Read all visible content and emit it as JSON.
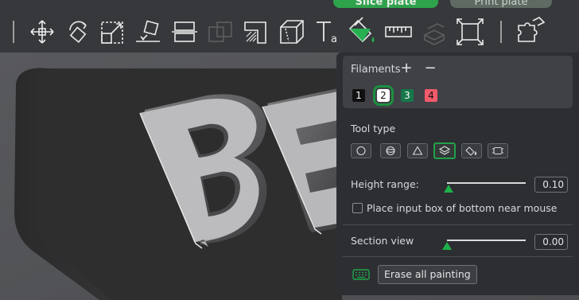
{
  "topbar": {
    "slice_button": "Slice plate",
    "print_button": "Print plate"
  },
  "toolbar": {
    "tools": [
      "move-icon",
      "rotate-icon",
      "scale-icon",
      "lay-on-face-icon",
      "cut-icon",
      "boolean-icon",
      "support-painting-icon",
      "seam-painting-icon",
      "text-icon",
      "color-painting-icon",
      "measure-icon",
      "assembly-icon",
      "fit-icon",
      "split-icon"
    ]
  },
  "viewport": {
    "model_text": "BE"
  },
  "panel": {
    "filaments_label": "Filaments",
    "add_symbol": "+",
    "remove_symbol": "−",
    "filaments": [
      {
        "label": "1",
        "color": "#111111",
        "text_color": "#ffffff",
        "selected": false
      },
      {
        "label": "2",
        "color": "#ffffff",
        "text_color": "#111111",
        "selected": true
      },
      {
        "label": "3",
        "color": "#16784a",
        "text_color": "#ffffff",
        "selected": false
      },
      {
        "label": "4",
        "color": "#f25a6a",
        "text_color": "#111111",
        "selected": false
      }
    ],
    "tool_type_label": "Tool type",
    "tool_types": [
      "circle-brush-icon",
      "sphere-brush-icon",
      "triangle-icon",
      "height-range-icon",
      "fill-bucket-icon",
      "gap-fill-icon"
    ],
    "active_tool_index": 3,
    "height_range_label": "Height range:",
    "height_range_value": "0.10",
    "height_range_fraction": 0.02,
    "place_input_label": "Place input box of bottom near mouse",
    "place_input_checked": false,
    "section_view_label": "Section view",
    "section_view_value": "0.00",
    "section_view_fraction": 0.0,
    "erase_label": "Erase all painting",
    "accent": "#1eb04a"
  }
}
